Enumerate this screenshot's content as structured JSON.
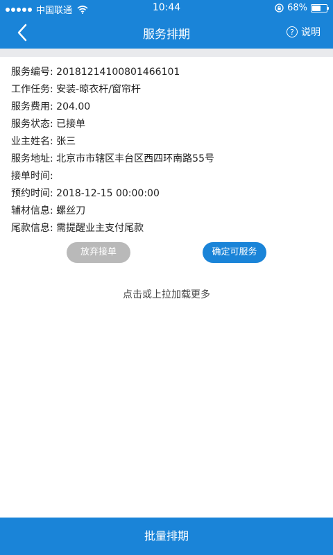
{
  "status_bar": {
    "carrier": "中国联通",
    "time": "10:44",
    "battery_percent": "68%",
    "battery_level": 0.68,
    "icons": [
      "signal-dots-icon",
      "wifi-icon",
      "orientation-lock-icon",
      "battery-icon"
    ]
  },
  "nav": {
    "title": "服务排期",
    "help_label": "说明",
    "back_icon": "chevron-left-icon",
    "help_icon": "question-circle-icon"
  },
  "order": {
    "rows": [
      "服务编号: 20181214100801466101",
      "工作任务: 安装-晾衣杆/窗帘杆",
      "服务费用: 204.00",
      "服务状态: 已接单",
      "业主姓名: 张三",
      "服务地址: 北京市市辖区丰台区西四环南路55号",
      "接单时间:",
      "预约时间: 2018-12-15 00:00:00",
      "辅材信息: 螺丝刀",
      "尾款信息: 需提醒业主支付尾款"
    ]
  },
  "actions": {
    "abandon_label": "放弃接单",
    "confirm_label": "确定可服务"
  },
  "load_more_label": "点击或上拉加载更多",
  "bottom_bar_label": "批量排期",
  "colors": {
    "primary": "#1a84d8",
    "disabled": "#b9b9b9",
    "band": "#e9eaed"
  }
}
